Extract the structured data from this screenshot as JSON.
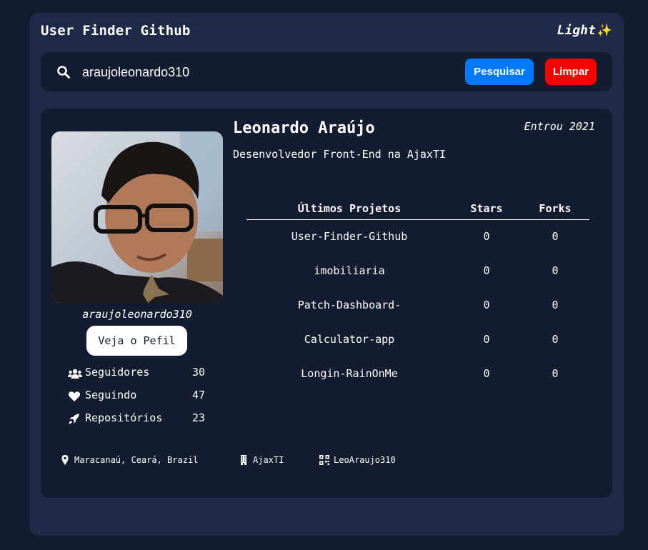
{
  "header": {
    "title": "User Finder Github",
    "theme_label": "Light",
    "theme_icon": "sparkle-icon"
  },
  "search": {
    "value": "araujoleonardo310",
    "search_button": "Pesquisar",
    "clear_button": "Limpar"
  },
  "profile": {
    "login": "araujoleonardo310",
    "view_profile_button": "Veja o Pefil",
    "name": "Leonardo Araújo",
    "joined": "Entrou 2021",
    "bio": "Desenvolvedor Front-End na AjaxTI",
    "stats": [
      {
        "icon": "users-icon",
        "label": "Seguidores",
        "value": "30"
      },
      {
        "icon": "heart-icon",
        "label": "Seguindo",
        "value": "47"
      },
      {
        "icon": "rocket-icon",
        "label": "Repositórios",
        "value": "23"
      }
    ]
  },
  "projects": {
    "headers": {
      "name": "Últimos Projetos",
      "stars": "Stars",
      "forks": "Forks"
    },
    "rows": [
      {
        "name": "User-Finder-Github",
        "stars": "0",
        "forks": "0"
      },
      {
        "name": "imobiliaria",
        "stars": "0",
        "forks": "0"
      },
      {
        "name": "Patch-Dashboard-",
        "stars": "0",
        "forks": "0"
      },
      {
        "name": "Calculator-app",
        "stars": "0",
        "forks": "0"
      },
      {
        "name": "Longin-RainOnMe",
        "stars": "0",
        "forks": "0"
      }
    ]
  },
  "footer": {
    "location": "Maracanaú, Ceará, Brazil",
    "company": "AjaxTI",
    "twitter": "LeoAraujo310"
  },
  "colors": {
    "background": "#141c2f",
    "panel": "#1f2a48",
    "primary_button": "#0079ff",
    "danger_button": "#f70000",
    "text": "#ffffff"
  }
}
